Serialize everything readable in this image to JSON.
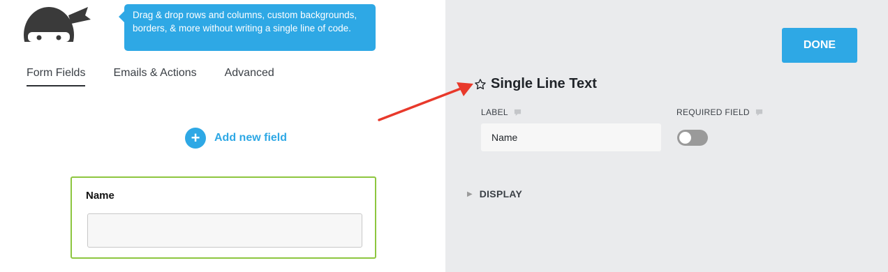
{
  "tooltip": {
    "text": "Drag & drop rows and columns, custom backgrounds, borders, & more without writing a single line of code."
  },
  "tabs": [
    {
      "label": "Form Fields",
      "active": true
    },
    {
      "label": "Emails & Actions",
      "active": false
    },
    {
      "label": "Advanced",
      "active": false
    }
  ],
  "add_field": {
    "label": "Add new field",
    "icon": "plus-circle-icon"
  },
  "field_preview": {
    "name": "Name",
    "input_value": ""
  },
  "settings": {
    "done_label": "DONE",
    "field_type": "Single Line Text",
    "label_header": "LABEL",
    "label_value": "Name",
    "required_header": "REQUIRED FIELD",
    "required_on": false,
    "display_label": "DISPLAY"
  },
  "colors": {
    "accent": "#2ea8e5",
    "card_border": "#8dc63f",
    "arrow": "#e8392b",
    "right_bg": "#eaebed"
  }
}
